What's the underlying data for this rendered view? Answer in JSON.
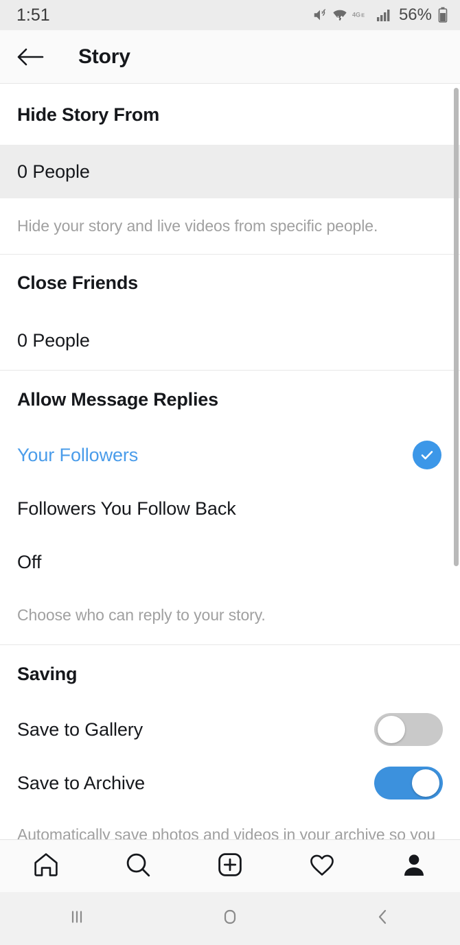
{
  "status_bar": {
    "time": "1:51",
    "battery_percent": "56%",
    "icons": [
      "mute-vibrate-icon",
      "wifi-data-icon",
      "4g-lte-icon",
      "signal-bars-icon",
      "battery-icon"
    ]
  },
  "header": {
    "back_label": "back-arrow",
    "title": "Story"
  },
  "sections": [
    {
      "heading": "Hide Story From",
      "rows": [
        {
          "label": "0 People",
          "highlighted": true
        }
      ],
      "description": "Hide your story and live videos from specific people."
    },
    {
      "heading": "Close Friends",
      "rows": [
        {
          "label": "0 People",
          "highlighted": false
        }
      ],
      "description": ""
    },
    {
      "heading": "Allow Message Replies",
      "rows": [
        {
          "label": "Your Followers",
          "selected": true
        },
        {
          "label": "Followers You Follow Back",
          "selected": false
        },
        {
          "label": "Off",
          "selected": false
        }
      ],
      "description": "Choose who can reply to your story."
    },
    {
      "heading": "Saving",
      "rows": [
        {
          "label": "Save to Gallery",
          "toggle": "off"
        },
        {
          "label": "Save to Archive",
          "toggle": "on"
        }
      ],
      "description": "Automatically save photos and videos in your archive so you don't have to save them on your phone. Only you can see them"
    }
  ],
  "tabbar": {
    "items": [
      {
        "name": "home-icon",
        "label": "Home"
      },
      {
        "name": "search-icon",
        "label": "Search"
      },
      {
        "name": "add-post-icon",
        "label": "New Post"
      },
      {
        "name": "heart-icon",
        "label": "Activity"
      },
      {
        "name": "profile-icon",
        "label": "Profile"
      }
    ]
  },
  "navbar": {
    "items": [
      {
        "name": "recents-icon",
        "label": "Recents"
      },
      {
        "name": "home-button-icon",
        "label": "Home"
      },
      {
        "name": "back-button-icon",
        "label": "Back"
      }
    ]
  },
  "colors": {
    "accent_blue": "#3c97e8",
    "selected_text_blue": "#4a9cea",
    "toggle_on": "#3c91dd",
    "toggle_off": "#c9c9c9",
    "highlight_row": "#ededed",
    "text_primary": "#16181c",
    "text_muted": "#a0a0a0"
  }
}
